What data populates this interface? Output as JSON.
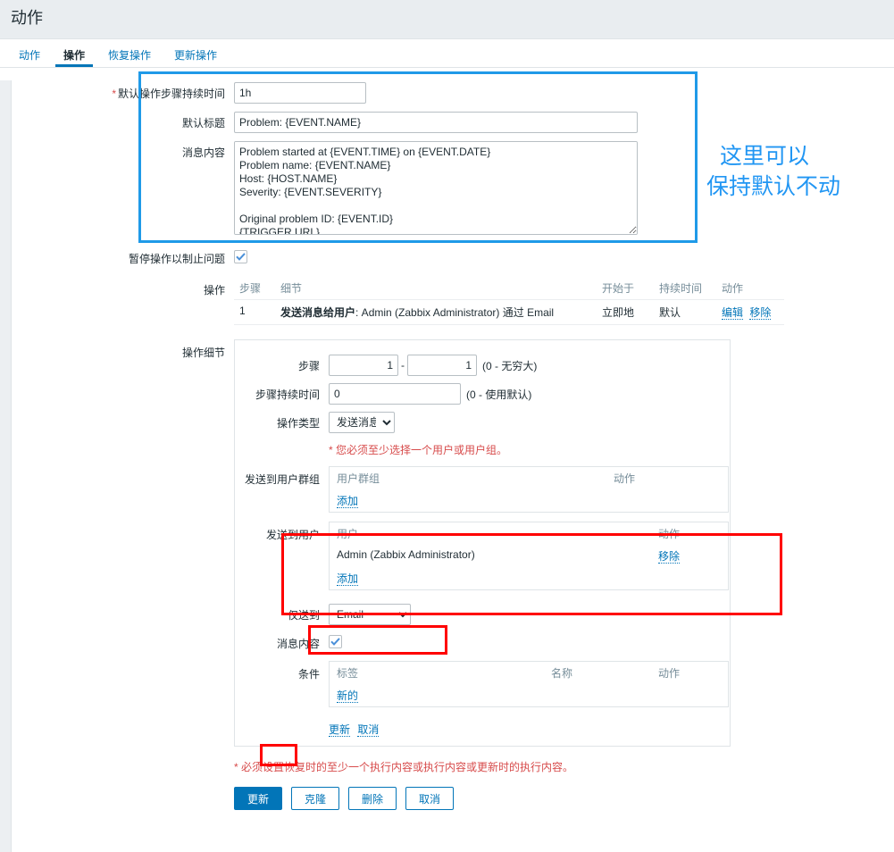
{
  "header": {
    "title": "动作"
  },
  "tabs": [
    {
      "label": "动作",
      "active": false
    },
    {
      "label": "操作",
      "active": true
    },
    {
      "label": "恢复操作",
      "active": false
    },
    {
      "label": "更新操作",
      "active": false
    }
  ],
  "form": {
    "default_step_duration": {
      "label": "默认操作步骤持续时间",
      "required": true,
      "value": "1h"
    },
    "default_subject": {
      "label": "默认标题",
      "value": "Problem: {EVENT.NAME}"
    },
    "message_content": {
      "label": "消息内容",
      "value": "Problem started at {EVENT.TIME} on {EVENT.DATE}\nProblem name: {EVENT.NAME}\nHost: {HOST.NAME}\nSeverity: {EVENT.SEVERITY}\n\nOriginal problem ID: {EVENT.ID}\n{TRIGGER.URL}"
    },
    "pause_operations": {
      "label": "暂停操作以制止问题",
      "checked": true
    }
  },
  "operations": {
    "label": "操作",
    "columns": [
      "步骤",
      "细节",
      "开始于",
      "持续时间",
      "动作"
    ],
    "rows": [
      {
        "step": "1",
        "detail_bold": "发送消息给用户",
        "detail_rest": ": Admin (Zabbix Administrator) 通过 Email",
        "start": "立即地",
        "duration": "默认",
        "edit": "编辑",
        "remove": "移除"
      }
    ]
  },
  "operation_details": {
    "label": "操作细节",
    "steps": {
      "label": "步骤",
      "from": "1",
      "to": "1",
      "separator": "-",
      "hint": "(0 - 无穷大)"
    },
    "step_duration": {
      "label": "步骤持续时间",
      "value": "0",
      "hint": "(0 - 使用默认)"
    },
    "operation_type": {
      "label": "操作类型",
      "selected": "发送消息",
      "options": [
        "发送消息"
      ]
    },
    "required_note": {
      "star": "*",
      "text": " 您必须至少选择一个用户或用户组。"
    },
    "send_to_user_groups": {
      "label": "发送到用户群组",
      "col_name": "用户群组",
      "col_action": "动作",
      "rows": [],
      "add_label": "添加"
    },
    "send_to_users": {
      "label": "发送到用户",
      "col_name": "用户",
      "col_action": "动作",
      "rows": [
        {
          "name": "Admin (Zabbix Administrator)",
          "action": "移除"
        }
      ],
      "add_label": "添加"
    },
    "send_only_to": {
      "label": "仅送到",
      "selected": "Email",
      "options": [
        "Email"
      ]
    },
    "custom_message": {
      "label": "消息内容",
      "checked": true
    },
    "conditions": {
      "label": "条件",
      "col_tag": "标签",
      "col_name": "名称",
      "col_action": "动作",
      "rows": [],
      "new_label": "新的"
    },
    "update_link": "更新",
    "cancel_link": "取消"
  },
  "footer": {
    "note": {
      "star": "*",
      "text": " 必须设置恢复时的至少一个执行内容或执行内容或更新时的执行内容。"
    },
    "buttons": [
      {
        "label": "更新",
        "primary": true
      },
      {
        "label": "克隆",
        "primary": false
      },
      {
        "label": "删除",
        "primary": false
      },
      {
        "label": "取消",
        "primary": false
      }
    ]
  },
  "annotations": {
    "note_line1": "这里可以",
    "note_line2": "保持默认不动",
    "blue_color": "#1f9ae8",
    "red_color": "#ff0000",
    "text_color": "#2196f3"
  }
}
